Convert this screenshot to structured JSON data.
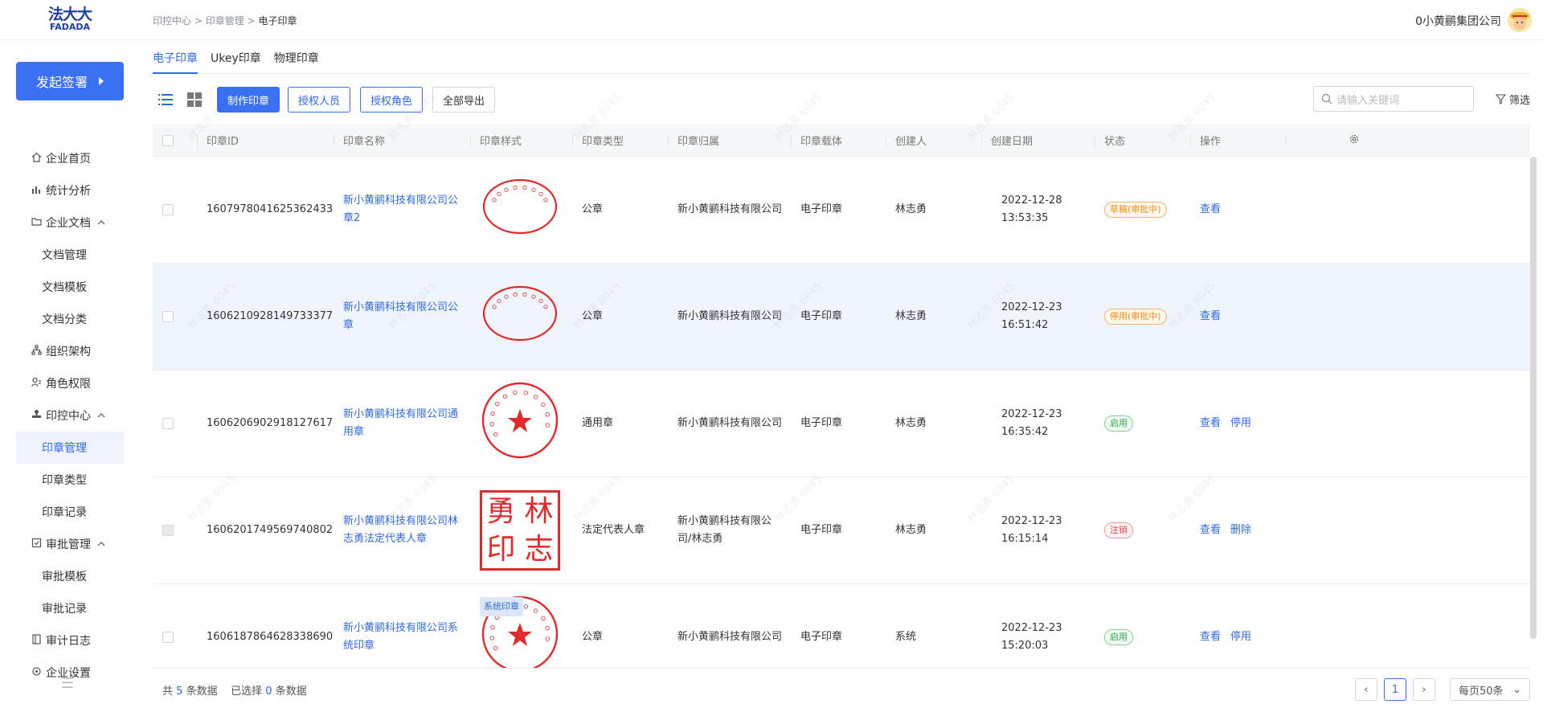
{
  "logo": {
    "cn": "法大大",
    "en": "FADADA"
  },
  "breadcrumb": {
    "level1": "印控中心",
    "level2": "印章管理",
    "current": "电子印章",
    "sep": ">"
  },
  "header": {
    "company": "0小黄鹂集团公司"
  },
  "sidebar": {
    "start_label": "发起签署",
    "items": [
      {
        "label": "企业首页",
        "icon": "home-icon"
      },
      {
        "label": "统计分析",
        "icon": "chart-icon"
      },
      {
        "label": "企业文档",
        "icon": "folder-icon",
        "expanded": true
      },
      {
        "label": "文档管理",
        "sub": true
      },
      {
        "label": "文档模板",
        "sub": true
      },
      {
        "label": "文档分类",
        "sub": true
      },
      {
        "label": "组织架构",
        "icon": "org-icon"
      },
      {
        "label": "角色权限",
        "icon": "role-icon"
      },
      {
        "label": "印控中心",
        "icon": "stamp-icon",
        "expanded": true
      },
      {
        "label": "印章管理",
        "sub": true,
        "active": true
      },
      {
        "label": "印章类型",
        "sub": true
      },
      {
        "label": "印章记录",
        "sub": true
      },
      {
        "label": "审批管理",
        "icon": "approval-icon",
        "expanded": true
      },
      {
        "label": "审批模板",
        "sub": true
      },
      {
        "label": "审批记录",
        "sub": true
      },
      {
        "label": "审计日志",
        "icon": "log-icon"
      },
      {
        "label": "企业设置",
        "icon": "settings-icon"
      }
    ]
  },
  "tabs": [
    "电子印章",
    "Ukey印章",
    "物理印章"
  ],
  "toolbar": {
    "make_seal": "制作印章",
    "auth_person": "授权人员",
    "auth_role": "授权角色",
    "export_all": "全部导出",
    "search_placeholder": "请输入关键词",
    "filter": "筛选"
  },
  "table": {
    "columns": [
      "印章ID",
      "印章名称",
      "印章样式",
      "印章类型",
      "印章归属",
      "印章载体",
      "创建人",
      "创建日期",
      "状态",
      "操作"
    ],
    "rows": [
      {
        "id": "1607978041625362433",
        "name": "新小黄鹂科技有限公司公章2",
        "seal_style": "oval",
        "type": "公章",
        "owner": "新小黄鹂科技有限公司",
        "carrier": "电子印章",
        "creator": "林志勇",
        "date": "2022-12-28 13:53:35",
        "status": "草稿(审批中)",
        "status_color": "orange",
        "ops": [
          "查看"
        ]
      },
      {
        "id": "1606210928149733377",
        "name": "新小黄鹂科技有限公司公章",
        "seal_style": "oval",
        "type": "公章",
        "owner": "新小黄鹂科技有限公司",
        "carrier": "电子印章",
        "creator": "林志勇",
        "date": "2022-12-23 16:51:42",
        "status": "停用(审批中)",
        "status_color": "orange",
        "ops": [
          "查看"
        ]
      },
      {
        "id": "1606206902918127617",
        "name": "新小黄鹂科技有限公司通用章",
        "seal_style": "round-star",
        "type": "通用章",
        "owner": "新小黄鹂科技有限公司",
        "carrier": "电子印章",
        "creator": "林志勇",
        "date": "2022-12-23 16:35:42",
        "status": "启用",
        "status_color": "green",
        "ops": [
          "查看",
          "停用"
        ]
      },
      {
        "id": "1606201749569740802",
        "name": "新小黄鹂科技有限公司林志勇法定代表人章",
        "seal_style": "square",
        "seal_chars": [
          "勇",
          "林",
          "印",
          "志"
        ],
        "type": "法定代表人章",
        "owner": "新小黄鹂科技有限公司/林志勇",
        "carrier": "电子印章",
        "creator": "林志勇",
        "date": "2022-12-23 16:15:14",
        "status": "注销",
        "status_color": "red",
        "ops": [
          "查看",
          "删除"
        ]
      },
      {
        "id": "1606187864628338690",
        "name": "新小黄鹂科技有限公司系统印章",
        "seal_style": "round-star",
        "tag": "系统印章",
        "type": "公章",
        "owner": "新小黄鹂科技有限公司",
        "carrier": "电子印章",
        "creator": "系统",
        "date": "2022-12-23 15:20:03",
        "status": "启用",
        "status_color": "green",
        "ops": [
          "查看",
          "停用"
        ]
      }
    ]
  },
  "footer": {
    "prefix": "共",
    "total": "5",
    "total_suffix": "条数据",
    "sel_prefix": "已选择",
    "selected": "0",
    "sel_suffix": "条数据",
    "page": "1",
    "page_size": "每页50条"
  },
  "watermark": "林志勇 6045",
  "colors": {
    "primary": "#3a71f2",
    "seal_red": "#e22a2a"
  }
}
